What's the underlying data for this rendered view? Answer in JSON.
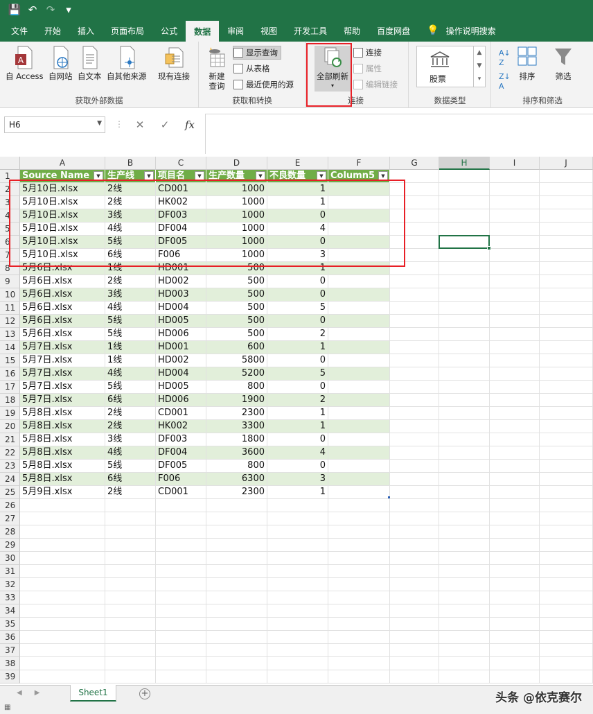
{
  "qat": {
    "save": "💾",
    "undo": "↶",
    "redo": "↷",
    "customize": "▾"
  },
  "tabs": [
    {
      "label": "文件"
    },
    {
      "label": "开始"
    },
    {
      "label": "插入"
    },
    {
      "label": "页面布局"
    },
    {
      "label": "公式"
    },
    {
      "label": "数据",
      "active": true
    },
    {
      "label": "审阅"
    },
    {
      "label": "视图"
    },
    {
      "label": "开发工具"
    },
    {
      "label": "帮助"
    },
    {
      "label": "百度网盘"
    },
    {
      "label": "操作说明搜索",
      "icon": "lightbulb-icon"
    }
  ],
  "ribbon": {
    "get_external": {
      "label": "获取外部数据",
      "from_access": "自 Access",
      "from_web": "自网站",
      "from_text": "自文本",
      "from_other": "自其他来源",
      "existing": "现有连接"
    },
    "get_transform": {
      "label": "获取和转换",
      "new_query_1": "新建",
      "new_query_2": "查询",
      "show_queries": "显示查询",
      "from_table": "从表格",
      "recent_sources": "最近使用的源"
    },
    "connections": {
      "label": "连接",
      "refresh_all": "全部刷新",
      "connections": "连接",
      "properties": "属性",
      "edit_links": "编辑链接"
    },
    "data_types": {
      "label": "数据类型",
      "stocks": "股票"
    },
    "sort_filter": {
      "label": "排序和筛选",
      "sort": "排序",
      "filter": "筛选"
    }
  },
  "formula_bar": {
    "name_box": "H6",
    "cancel": "✕",
    "enter": "✓",
    "fx": "fx",
    "value": ""
  },
  "columns": [
    "A",
    "B",
    "C",
    "D",
    "E",
    "F",
    "G",
    "H",
    "I",
    "J"
  ],
  "table": {
    "headers": [
      "Source Name",
      "生产线",
      "项目名",
      "生产数量",
      "不良数量",
      "Column5"
    ],
    "rows": [
      [
        "5月10日.xlsx",
        "2线",
        "CD001",
        "1000",
        "1"
      ],
      [
        "5月10日.xlsx",
        "2线",
        "HK002",
        "1000",
        "1"
      ],
      [
        "5月10日.xlsx",
        "3线",
        "DF003",
        "1000",
        "0"
      ],
      [
        "5月10日.xlsx",
        "4线",
        "DF004",
        "1000",
        "4"
      ],
      [
        "5月10日.xlsx",
        "5线",
        "DF005",
        "1000",
        "0"
      ],
      [
        "5月10日.xlsx",
        "6线",
        "F006",
        "1000",
        "3"
      ],
      [
        "5月6日.xlsx",
        "1线",
        "HD001",
        "500",
        "1"
      ],
      [
        "5月6日.xlsx",
        "2线",
        "HD002",
        "500",
        "0"
      ],
      [
        "5月6日.xlsx",
        "3线",
        "HD003",
        "500",
        "0"
      ],
      [
        "5月6日.xlsx",
        "4线",
        "HD004",
        "500",
        "5"
      ],
      [
        "5月6日.xlsx",
        "5线",
        "HD005",
        "500",
        "0"
      ],
      [
        "5月6日.xlsx",
        "5线",
        "HD006",
        "500",
        "2"
      ],
      [
        "5月7日.xlsx",
        "1线",
        "HD001",
        "600",
        "1"
      ],
      [
        "5月7日.xlsx",
        "1线",
        "HD002",
        "5800",
        "0"
      ],
      [
        "5月7日.xlsx",
        "4线",
        "HD004",
        "5200",
        "5"
      ],
      [
        "5月7日.xlsx",
        "5线",
        "HD005",
        "800",
        "0"
      ],
      [
        "5月7日.xlsx",
        "6线",
        "HD006",
        "1900",
        "2"
      ],
      [
        "5月8日.xlsx",
        "2线",
        "CD001",
        "2300",
        "1"
      ],
      [
        "5月8日.xlsx",
        "2线",
        "HK002",
        "3300",
        "1"
      ],
      [
        "5月8日.xlsx",
        "3线",
        "DF003",
        "1800",
        "0"
      ],
      [
        "5月8日.xlsx",
        "4线",
        "DF004",
        "3600",
        "4"
      ],
      [
        "5月8日.xlsx",
        "5线",
        "DF005",
        "800",
        "0"
      ],
      [
        "5月8日.xlsx",
        "6线",
        "F006",
        "6300",
        "3"
      ],
      [
        "5月9日.xlsx",
        "2线",
        "CD001",
        "2300",
        "1"
      ]
    ],
    "visible_row_count": 39
  },
  "sheets": {
    "active": "Sheet1",
    "add": "+"
  },
  "watermark": "头条 @依克赛尔",
  "colors": {
    "excel_green": "#217346",
    "table_header": "#70ad47",
    "band": "#e2efda",
    "highlight_red": "#e81f26"
  }
}
